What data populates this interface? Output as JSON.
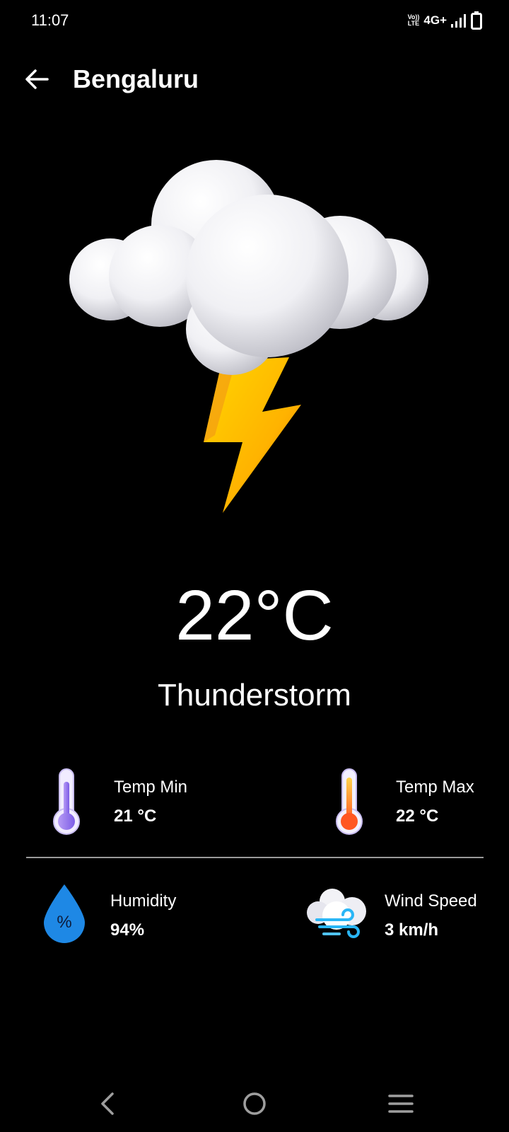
{
  "status_bar": {
    "time": "11:07",
    "volte_top": "Vo))",
    "volte_bottom": "LTE",
    "network": "4G+"
  },
  "header": {
    "city": "Bengaluru",
    "back_icon": "arrow-left-icon"
  },
  "current": {
    "temperature": "22°C",
    "condition": "Thunderstorm",
    "illustration": "cloud-lightning-icon"
  },
  "stats": {
    "temp_min": {
      "label": "Temp Min",
      "value": "21 °C",
      "icon": "thermometer-cold-icon"
    },
    "temp_max": {
      "label": "Temp Max",
      "value": "22 °C",
      "icon": "thermometer-hot-icon"
    },
    "humidity": {
      "label": "Humidity",
      "value": "94%",
      "icon": "humidity-drop-icon",
      "icon_text": "%"
    },
    "wind_speed": {
      "label": "Wind Speed",
      "value": "3 km/h",
      "icon": "wind-cloud-icon"
    }
  },
  "nav": {
    "back": "nav-back-icon",
    "home": "nav-home-icon",
    "menu": "nav-menu-icon"
  },
  "colors": {
    "background": "#000000",
    "text": "#ffffff",
    "divider": "#9a9a9a",
    "lightning": "#ffb300",
    "humidity_drop": "#1e88e5"
  }
}
